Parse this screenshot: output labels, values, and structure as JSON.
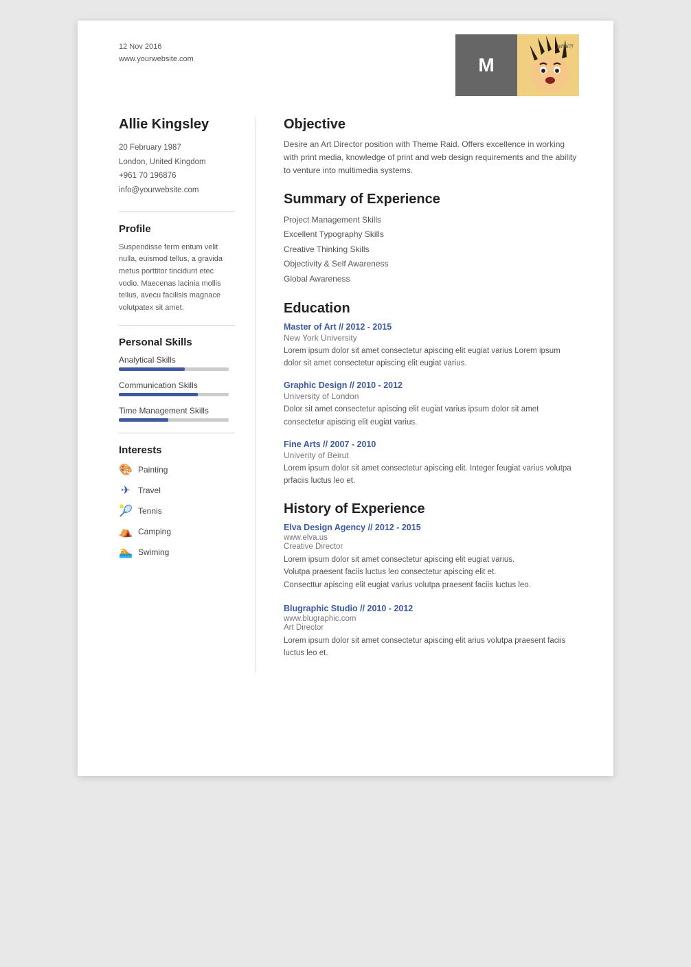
{
  "header": {
    "date": "12 Nov 2016",
    "website": "www.yourwebsite.com",
    "monogram": "M",
    "whatbubble": "what?!"
  },
  "left": {
    "name": "Allie Kingsley",
    "contact": {
      "dob": "20 February 1987",
      "location": "London, United Kingdom",
      "phone": "+961 70 196876",
      "email": "info@yourwebsite.com"
    },
    "profile_title": "Profile",
    "profile_text": "Suspendisse ferm entum velit nulla, euismod tellus, a gravida metus porttitor tincidunt etec vodio. Maecenas lacinia mollis tellus, avecu facilisis magnace volutpatex sit amet.",
    "skills_title": "Personal Skills",
    "skills": [
      {
        "label": "Analytical Skills",
        "percent": 60
      },
      {
        "label": "Communication Skills",
        "percent": 72
      },
      {
        "label": "Time Management Skills",
        "percent": 45
      }
    ],
    "interests_title": "Interests",
    "interests": [
      {
        "icon": "🎨",
        "label": "Painting"
      },
      {
        "icon": "✈",
        "label": "Travel"
      },
      {
        "icon": "🎾",
        "label": "Tennis"
      },
      {
        "icon": "⛺",
        "label": "Camping"
      },
      {
        "icon": "🏊",
        "label": "Swiming"
      }
    ]
  },
  "right": {
    "objective_title": "Objective",
    "objective_text": "Desire an Art Director position with Theme Raid. Offers excellence in working with print media, knowledge of print and web design requirements and the ability to venture into multimedia systems.",
    "summary_title": "Summary of Experience",
    "summary_items": [
      "Project Management Skills",
      "Excellent Typography Skills",
      "Creative Thinking Skills",
      "Objectivity & Self Awareness",
      "Global Awareness"
    ],
    "education_title": "Education",
    "education": [
      {
        "title": "Master of Art // 2012 - 2015",
        "school": "New York University",
        "desc": "Lorem ipsum dolor sit amet consectetur apiscing elit eugiat varius Lorem ipsum dolor sit amet consectetur apiscing elit eugiat varius."
      },
      {
        "title": "Graphic Design // 2010 - 2012",
        "school": "University of London",
        "desc": "Dolor sit amet consectetur apiscing elit eugiat varius  ipsum dolor sit amet consectetur apiscing elit eugiat varius."
      },
      {
        "title": "Fine Arts // 2007 - 2010",
        "school": "Univerity of Beirut",
        "desc": "Lorem ipsum dolor sit amet consectetur apiscing elit. Integer feugiat varius volutpa prfaciis luctus leo et."
      }
    ],
    "history_title": "History of Experience",
    "history": [
      {
        "title": "Elva Design Agency // 2012 - 2015",
        "url": "www.elva.us",
        "role": "Creative Director",
        "desc": "Lorem ipsum dolor sit amet consectetur apiscing elit eugiat varius.\nVolutpa praesent faciis luctus leo consectetur apiscing elit et.\nConsecttur apiscing elit eugiat varius volutpa praesent faciis luctus leo."
      },
      {
        "title": "Blugraphic Studio // 2010 - 2012",
        "url": "www.blugraphic.com",
        "role": "Art Director",
        "desc": "Lorem ipsum dolor sit amet consectetur apiscing elit arius volutpa praesent faciis luctus leo et."
      }
    ]
  }
}
